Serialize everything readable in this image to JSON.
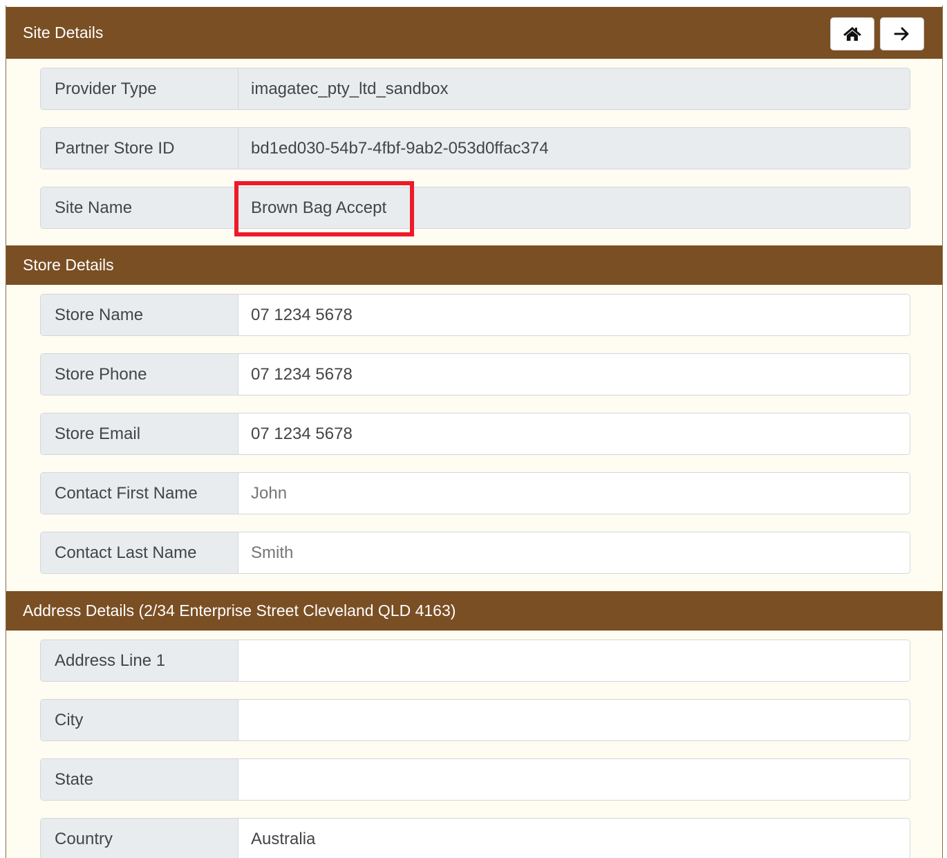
{
  "site_details": {
    "title": "Site Details",
    "buttons": {
      "home_icon": "home-icon",
      "next_icon": "arrow-right-icon"
    },
    "rows": [
      {
        "label": "Provider Type",
        "value": "imagatec_pty_ltd_sandbox"
      },
      {
        "label": "Partner Store ID",
        "value": "bd1ed030-54b7-4fbf-9ab2-053d0ffac374"
      },
      {
        "label": "Site Name",
        "value": "Brown Bag Accept"
      }
    ]
  },
  "store_details": {
    "title": "Store Details",
    "rows": [
      {
        "label": "Store Name",
        "value": "07 1234 5678"
      },
      {
        "label": "Store Phone",
        "value": "07 1234 5678"
      },
      {
        "label": "Store Email",
        "value": "07 1234 5678"
      },
      {
        "label": "Contact First Name",
        "placeholder": "John"
      },
      {
        "label": "Contact Last Name",
        "placeholder": "Smith"
      }
    ]
  },
  "address_details": {
    "title": "Address Details (2/34 Enterprise Street Cleveland QLD 4163)",
    "rows": [
      {
        "label": "Address Line 1",
        "value": ""
      },
      {
        "label": "City",
        "value": ""
      },
      {
        "label": "State",
        "value": ""
      },
      {
        "label": "Country",
        "value": "Australia"
      }
    ]
  },
  "colors": {
    "header_bg": "#7a4f24",
    "highlight": "#ee1a2a",
    "label_bg": "#e9ecef"
  }
}
